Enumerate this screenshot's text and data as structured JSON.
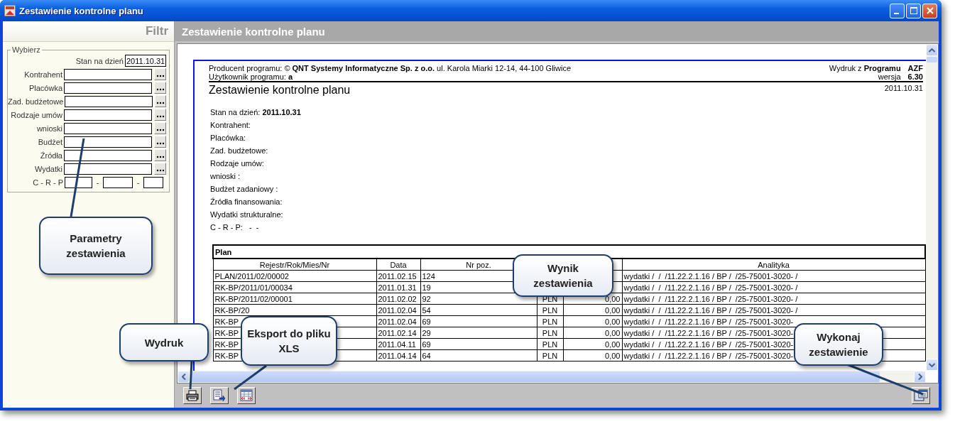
{
  "window": {
    "title": "Zestawienie kontrolne planu"
  },
  "filter_panel": {
    "heading": "Filtr",
    "group_title": "Wybierz",
    "date_label": "Stan na dzień",
    "date_value": "2011.10.31",
    "fields": [
      {
        "label": "Kontrahent"
      },
      {
        "label": "Placówka"
      },
      {
        "label": "Zad. budżetowe"
      },
      {
        "label": "Rodzaje umów"
      },
      {
        "label": "wnioski"
      },
      {
        "label": "Budżet"
      },
      {
        "label": "Źródła"
      },
      {
        "label": "Wydatki"
      }
    ],
    "crp_label": "C - R - P",
    "crp_separators": [
      "-",
      "-"
    ]
  },
  "report": {
    "header_bar": "Zestawienie kontrolne planu",
    "producer": "Producent programu: © **QNT Systemy Informatyczne Sp. z o.o.** ul. Karola Miarki 12-14, 44-100 Gliwice",
    "user": "Użytkownik programu: **a**",
    "printout": "Wydruk z **Programu**",
    "program": "AZF",
    "version_label": "wersja",
    "version": "6.30",
    "title": "Zestawienie kontrolne planu",
    "date": "2011.10.31",
    "params": [
      "Stan na dzień: **2011.10.31**",
      "Kontrahent:",
      "Placówka:",
      "Zad. budżetowe:",
      "Rodzaje umów:",
      "wnioski :",
      "Budżet zadaniowy :",
      "Źródła finansowania:",
      "Wydatki strukturalne:",
      "C - R - P:   -  -"
    ],
    "table": {
      "title": "Plan",
      "columns": [
        {
          "label": "Rejestr/Rok/Mies/Nr"
        },
        {
          "label": "Data"
        },
        {
          "label": "Nr poz."
        },
        {},
        {},
        {
          "label": "Analityka"
        }
      ],
      "rows": [
        [
          "PLAN/2011/02/00002",
          "2011.02.15",
          "124",
          null,
          null,
          "wydatki /  /  /11.22.2.1.16 / BP /  /25-75001-3020- /"
        ],
        [
          "RK-BP/2011/01/00034",
          "2011.01.31",
          "19",
          null,
          null,
          "wydatki /  /  /11.22.2.1.16 / BP /  /25-75001-3020- /"
        ],
        [
          "RK-BP/2011/02/00001",
          "2011.02.02",
          "92",
          "PLN",
          "0,00",
          "wydatki /  /  /11.22.2.1.16 / BP /  /25-75001-3020- /"
        ],
        [
          "RK-BP/20",
          "2011.02.04",
          "54",
          "PLN",
          "0,00",
          "wydatki /  /  /11.22.2.1.16 / BP /  /25-75001-3020- /"
        ],
        [
          "RK-BP",
          "2011.02.04",
          "69",
          "PLN",
          "0,00",
          "wydatki /  /  /11.22.2.1.16 / BP /  /25-75001-3020-"
        ],
        [
          "RK-BP",
          "2011.02.14",
          "29",
          "PLN",
          "0,00",
          "wydatki /  /  /11.22.2.1.16 / BP /  /25-75001-3020-"
        ],
        [
          "RK-BP",
          "2011.04.11",
          "69",
          "PLN",
          "0,00",
          "wydatki /  /  /11.22.2.1.16 / BP /  /25-75001-3020-"
        ],
        [
          "RK-BP",
          "2011.04.14",
          "64",
          "PLN",
          "0,00",
          "wydatki /  /  /11.22.2.1.16 / BP /  /25-75001-3020-"
        ]
      ]
    }
  },
  "callouts": [
    {
      "text": "Parametry zestawienia"
    },
    {
      "text": "Wynik zestawienia"
    },
    {
      "text": "Wydruk"
    },
    {
      "text": "Eksport do pliku XLS"
    },
    {
      "text": "Wykonaj zestawienie"
    }
  ]
}
